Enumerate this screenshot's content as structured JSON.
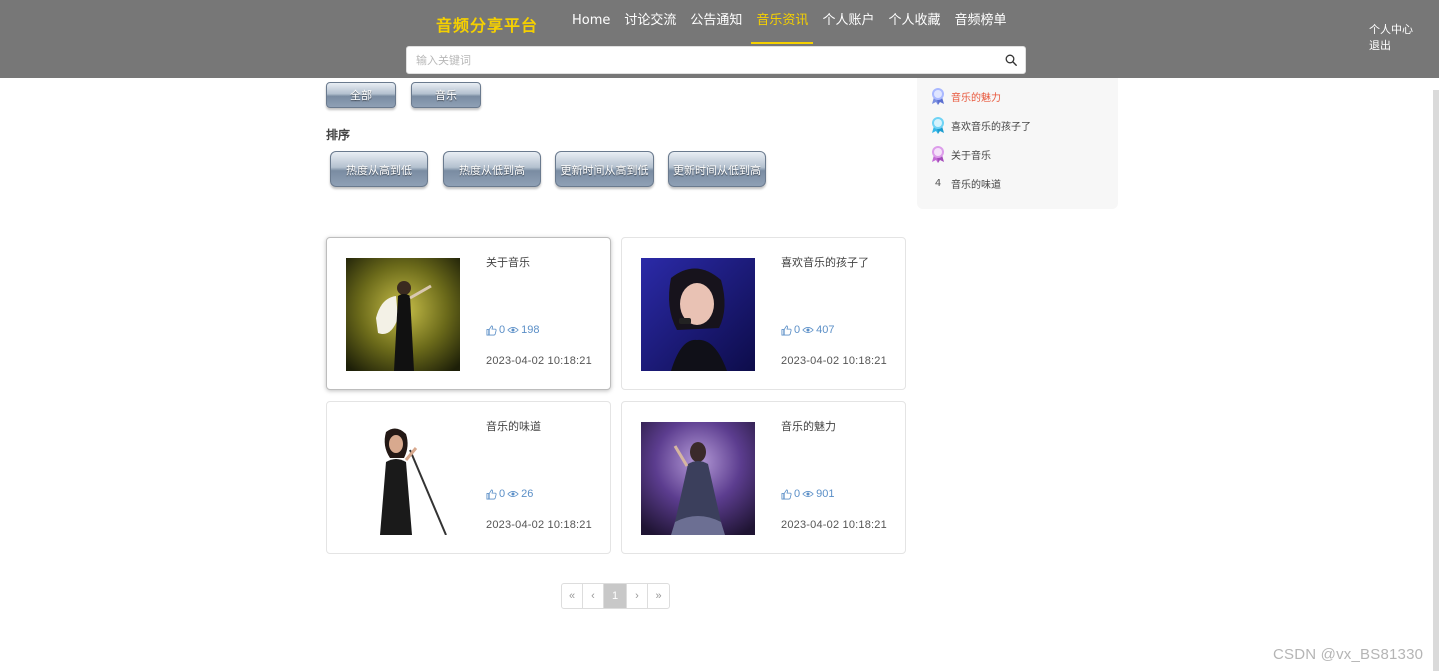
{
  "header": {
    "brand": "音频分享平台",
    "nav": [
      {
        "label": "Home"
      },
      {
        "label": "讨论交流"
      },
      {
        "label": "公告通知"
      },
      {
        "label": "音乐资讯"
      },
      {
        "label": "个人账户"
      },
      {
        "label": "个人收藏"
      },
      {
        "label": "音频榜单"
      }
    ],
    "active_nav": "音乐资讯",
    "user_center": "个人中心",
    "logout": "退出",
    "search_placeholder": "输入关键词",
    "brand_color": "#f5d000",
    "bar_color": "#777777"
  },
  "filters": {
    "category_buttons": [
      "全部",
      "音乐"
    ],
    "sort_label": "排序",
    "sort_buttons": [
      "热度从高到低",
      "热度从低到高",
      "更新时间从高到低",
      "更新时间从低到高"
    ]
  },
  "sidebar": {
    "items": [
      {
        "rank": "1",
        "title": "音乐的魅力"
      },
      {
        "rank": "2",
        "title": "喜欢音乐的孩子了"
      },
      {
        "rank": "3",
        "title": "关于音乐"
      },
      {
        "rank": "4",
        "title": "音乐的味道"
      }
    ]
  },
  "articles": [
    {
      "title": "关于音乐",
      "likes": "0",
      "views": "198",
      "date": "2023-04-02 10:18:21"
    },
    {
      "title": "喜欢音乐的孩子了",
      "likes": "0",
      "views": "407",
      "date": "2023-04-02 10:18:21"
    },
    {
      "title": "音乐的味道",
      "likes": "0",
      "views": "26",
      "date": "2023-04-02 10:18:21"
    },
    {
      "title": "音乐的魅力",
      "likes": "0",
      "views": "901",
      "date": "2023-04-02 10:18:21"
    }
  ],
  "pagination": {
    "first": "«",
    "prev": "‹",
    "current": "1",
    "next": "›",
    "last": "»"
  },
  "watermark": "CSDN @vx_BS81330"
}
